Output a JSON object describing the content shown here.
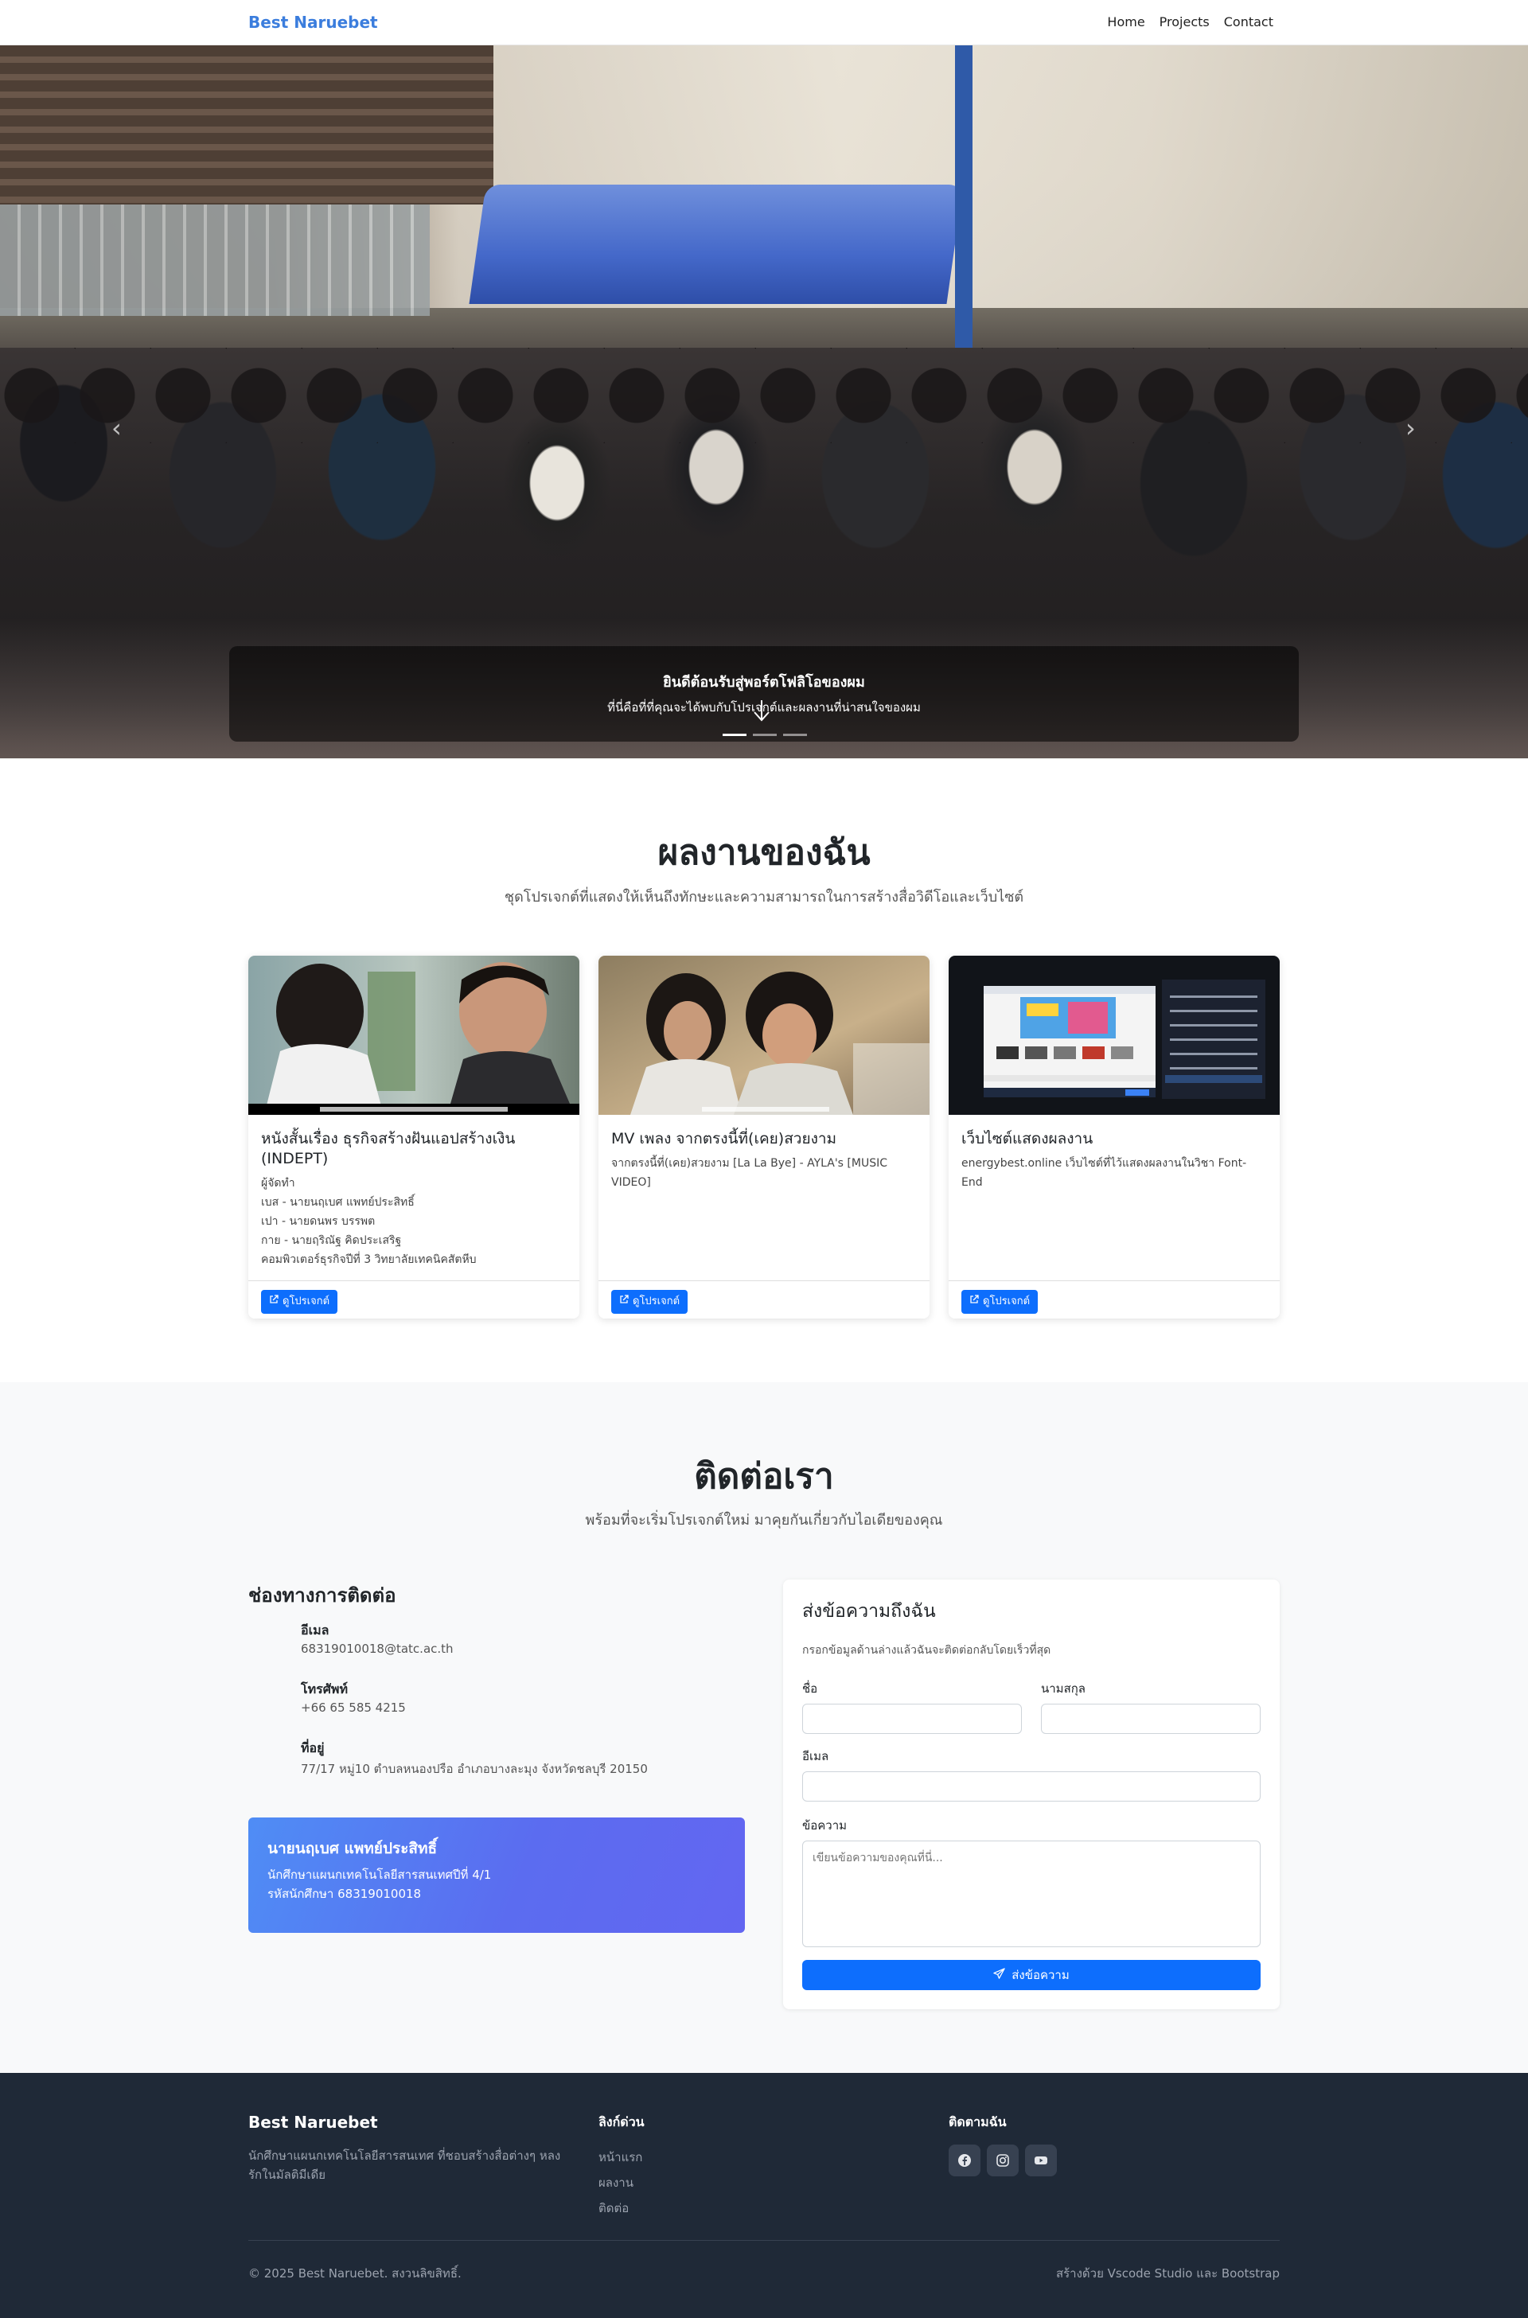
{
  "nav": {
    "brand": "Best Naruebet",
    "links": [
      "Home",
      "Projects",
      "Contact"
    ]
  },
  "hero": {
    "title": "ยินดีต้อนรับสู่พอร์ตโฟลิโอของผม",
    "subtitle": "ที่นี่คือที่ที่คุณจะได้พบกับโปรเจกต์และผลงานที่น่าสนใจของผม",
    "slide_count": 3,
    "active_slide": 1
  },
  "works": {
    "title": "ผลงานของฉัน",
    "subtitle": "ชุดโปรเจกต์ที่แสดงให้เห็นถึงทักษะและความสามารถในการสร้างสื่อวิดีโอและเว็บไซต์",
    "cards": [
      {
        "title": "หนังสั้นเรื่อง ธุรกิจสร้างฝันแอปสร้างเงิน (INDEPT)",
        "lines": [
          "ผู้จัดทำ",
          "เบส - นายนฤเบศ แพทย์ประสิทธิ์",
          "เปา - นายดนพร บรรพต",
          "กาย - นายฤริณัฐ คิดประเสริฐ",
          "คอมพิวเตอร์ธุรกิจปีที่ 3 วิทยาลัยเทคนิคสัตหีบ"
        ],
        "button": "ดูโปรเจกต์"
      },
      {
        "title": "MV เพลง จากตรงนี้ที่(เคย)สวยงาม",
        "lines": [
          "จากตรงนี้ที่(เคย)สวยงาม [La La Bye] - AYLA's [MUSIC VIDEO]"
        ],
        "button": "ดูโปรเจกต์"
      },
      {
        "title": "เว็บไซต์แสดงผลงาน",
        "lines": [
          "energybest.online เว็บไซต์ที่ไว้แสดงผลงานในวิชา Font-End"
        ],
        "button": "ดูโปรเจกต์"
      }
    ]
  },
  "contact": {
    "title": "ติดต่อเรา",
    "subtitle": "พร้อมที่จะเริ่มโปรเจกต์ใหม่ มาคุยกันเกี่ยวกับไอเดียของคุณ",
    "channels_heading": "ช่องทางการติดต่อ",
    "email_label": "อีเมล",
    "email_value": "68319010018@tatc.ac.th",
    "phone_label": "โทรศัพท์",
    "phone_value": "+66 65 585 4215",
    "address_label": "ที่อยู่",
    "address_value": "77/17 หมู่10 ตำบลหนองปรือ อำเภอบางละมุง จังหวัดชลบุรี 20150",
    "profile_name": "นายนฤเบศ แพทย์ประสิทธิ์",
    "profile_line1": "นักศึกษาแผนกเทคโนโลยีสารสนเทศปีที่ 4/1",
    "profile_line2": "รหัสนักศึกษา 68319010018",
    "form": {
      "title": "ส่งข้อความถึงฉัน",
      "description": "กรอกข้อมูลด้านล่างแล้วฉันจะติดต่อกลับโดยเร็วที่สุด",
      "first_name_label": "ชื่อ",
      "last_name_label": "นามสกุล",
      "email_label": "อีเมล",
      "message_label": "ข้อความ",
      "message_placeholder": "เขียนข้อความของคุณที่นี่...",
      "submit_label": "ส่งข้อความ"
    }
  },
  "footer": {
    "brand": "Best Naruebet",
    "description": "นักศึกษาแผนกเทคโนโลยีสารสนเทศ ที่ชอบสร้างสื่อต่างๆ หลงรักในมัลติมีเดีย",
    "quick_links_heading": "ลิงก์ด่วน",
    "quick_links": [
      "หน้าแรก",
      "ผลงาน",
      "ติดต่อ"
    ],
    "follow_heading": "ติดตามฉัน",
    "copyright": "© 2025 Best Naruebet. สงวนลิขสิทธิ์.",
    "made_with": "สร้างด้วย Vscode Studio และ Bootstrap"
  },
  "colors": {
    "brand": "#3b7ddd",
    "primary": "#0d6efd",
    "footer_bg": "#1f2937",
    "gradient_start": "#4f8df5",
    "gradient_end": "#6366f1"
  }
}
